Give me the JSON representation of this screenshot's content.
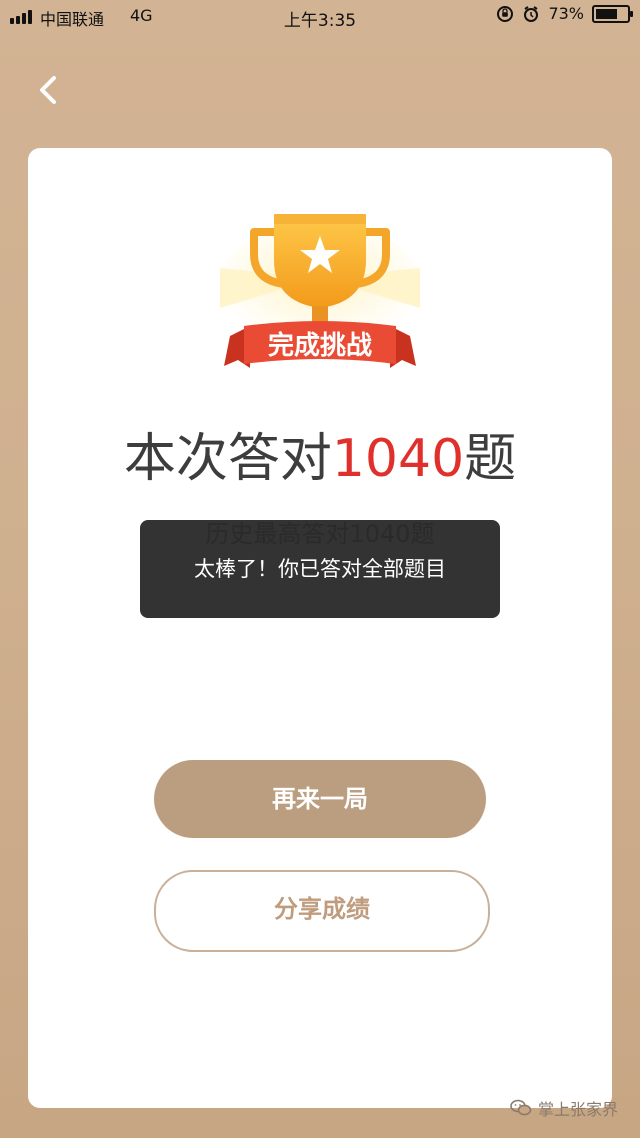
{
  "status_bar": {
    "carrier": "中国联通",
    "network": "4G",
    "time": "上午3:35",
    "battery": "73%",
    "battery_level": 0.73
  },
  "icons": {
    "back": "chevron-left-icon",
    "trophy": "trophy-icon",
    "signal": "signal-icon",
    "battery": "battery-icon",
    "alarm": "alarm-icon",
    "orientation_lock": "orientation-lock-icon",
    "wechat": "wechat-icon"
  },
  "result": {
    "badge_label": "完成挑战",
    "headline_prefix": "本次答对",
    "headline_number": "1040",
    "headline_suffix": "题",
    "history_best": "历史最高答对1040题",
    "toast_message": "太棒了！你已答对全部题目"
  },
  "actions": {
    "replay_label": "再来一局",
    "share_label": "分享成绩"
  },
  "watermark": {
    "label": "掌上张家界"
  },
  "colors": {
    "background": "#d2b393",
    "card": "#ffffff",
    "accent_red": "#e0302b",
    "primary_button": "#bb9e80",
    "secondary_border": "#c8b09a",
    "secondary_text": "#bf9c7e",
    "toast_background": "#222222",
    "trophy_gold": "#f5a623",
    "ribbon_red": "#e94b35"
  }
}
